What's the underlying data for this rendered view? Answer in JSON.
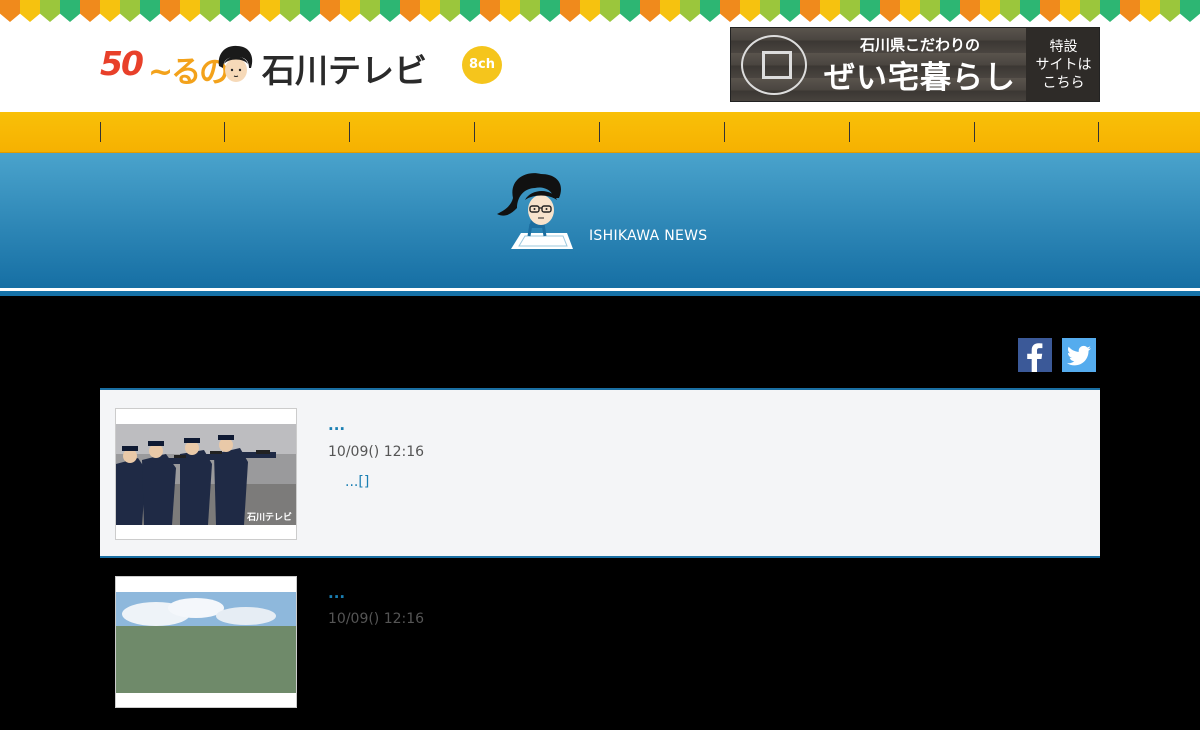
{
  "header": {
    "logo": {
      "number": "50",
      "tilde": "~るの",
      "name": "石川テレビ",
      "channel": "8ch"
    },
    "banner": {
      "circle_text": "石川県 こだわりの ぜい宅 暮らし",
      "sub": "石川県こだわりの",
      "main": "ぜい宅暮らし",
      "side": "特設\nサイトは\nこちら"
    }
  },
  "nav": {
    "items": [
      "",
      "",
      "",
      "",
      "",
      "",
      "",
      ""
    ]
  },
  "hero": {
    "title": "ISHIKAWA NEWS"
  },
  "social": {
    "facebook": "f",
    "twitter": "twitter"
  },
  "articles": [
    {
      "title": "...",
      "date": "10/09() 12:16",
      "more": "...[]",
      "thumb_caption": "石川テレビ"
    },
    {
      "title": "...",
      "date": "10/09() 12:16",
      "more": "",
      "thumb_caption": ""
    }
  ],
  "colors": {
    "accent_blue": "#1a7fb3",
    "nav_yellow": "#f9c008",
    "hero_top": "#4aa3cc",
    "hero_bottom": "#166fa4",
    "facebook": "#3b5998",
    "twitter": "#55acee"
  }
}
